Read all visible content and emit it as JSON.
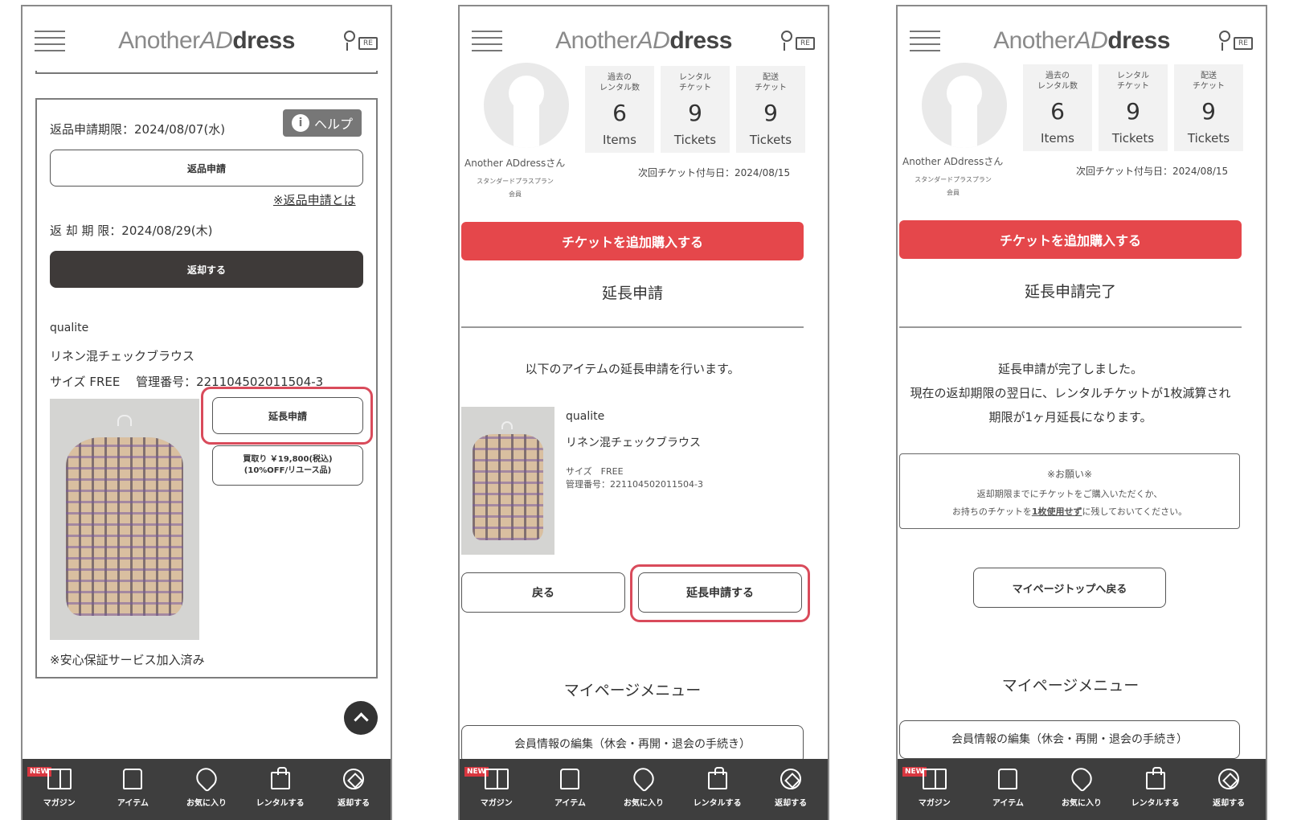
{
  "header": {
    "logo_light": "Another",
    "logo_italic": "AD",
    "logo_bold": "dress",
    "ticket_icon_label": "RE"
  },
  "nav": {
    "new_badge": "NEW",
    "items": [
      {
        "label": "マガジン",
        "icon": "magazine-icon"
      },
      {
        "label": "アイテム",
        "icon": "shirt-icon"
      },
      {
        "label": "お気に入り",
        "icon": "heart-icon"
      },
      {
        "label": "レンタルする",
        "icon": "shopping-bag-icon"
      },
      {
        "label": "返却する",
        "icon": "return-icon"
      }
    ]
  },
  "panel1": {
    "return_request_deadline": "返品申請期限：2024/08/07(水)",
    "help_label": "ヘルプ",
    "help_icon_glyph": "i",
    "return_request_button": "返品申請",
    "return_request_link": "※返品申請とは",
    "return_deadline": "返 却 期 限：2024/08/29(木)",
    "return_button": "返却する",
    "brand": "qualite",
    "item_name": "リネン混チェックブラウス",
    "size_and_id": "サイズ FREE　 管理番号：221104502011504-3",
    "extend_button": "延長申請",
    "buy_button_line1": "買取り ￥19,800(税込)",
    "buy_button_line2": "(10%OFF/リユース品)",
    "guarantee_note": "※安心保証サービス加入済み"
  },
  "profile": {
    "name": "Another ADdressさん",
    "plan_line1": "スタンダードプラスプラン",
    "plan_line2": "会員",
    "stats": [
      {
        "label_line1": "過去の",
        "label_line2": "レンタル数",
        "value": "6",
        "unit": "Items"
      },
      {
        "label_line1": "レンタル",
        "label_line2": "チケット",
        "value": "9",
        "unit": "Tickets"
      },
      {
        "label_line1": "配送",
        "label_line2": "チケット",
        "value": "9",
        "unit": "Tickets"
      }
    ],
    "next_ticket_date": "次回チケット付与日：2024/08/15",
    "buy_tickets_button": "チケットを追加購入する",
    "mypage_menu_title": "マイページメニュー",
    "menu_first_item": "会員情報の編集（休会・再開・退会の手続き）"
  },
  "panel2": {
    "section_title": "延長申請",
    "intro": "以下のアイテムの延長申請を行います。",
    "brand": "qualite",
    "item_name": "リネン混チェックブラウス",
    "size": "サイズ　FREE",
    "item_id": "管理番号：221104502011504-3",
    "back_button": "戻る",
    "submit_button": "延長申請する"
  },
  "panel3": {
    "section_title": "延長申請完了",
    "msg_line1": "延長申請が完了しました。",
    "msg_line2": "現在の返却期限の翌日に、レンタルチケットが1枚減算され",
    "msg_line3": "期限が1ヶ月延長になります。",
    "notice_title": "※お願い※",
    "notice_line1": "返却期限までにチケットをご購入いただくか、",
    "notice_line2_pre": "お持ちのチケットを",
    "notice_line2_em": "1枚使用せず",
    "notice_line2_post": "に残しておいてください。",
    "back_top_button": "マイページトップへ戻る"
  },
  "colors": {
    "accent_red": "#e5474b",
    "highlight": "#d94b5b",
    "dark": "#3e3a39"
  }
}
